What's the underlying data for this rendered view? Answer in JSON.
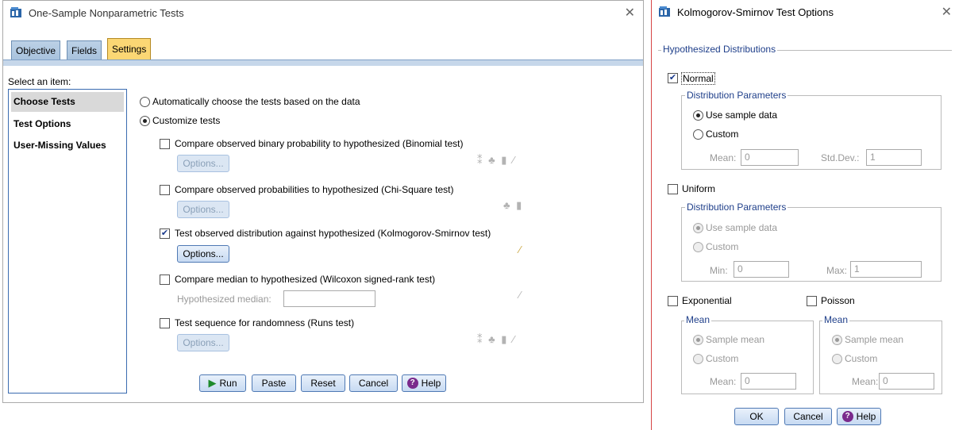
{
  "left_window": {
    "title": "One-Sample Nonparametric Tests",
    "tabs": [
      "Objective",
      "Fields",
      "Settings"
    ],
    "select_item_label": "Select an item:",
    "items": [
      "Choose Tests",
      "Test Options",
      "User-Missing Values"
    ],
    "auto_label": "Automatically choose the tests based on the data",
    "customize_label": "Customize tests",
    "tests": [
      {
        "label": "Compare observed binary probability to hypothesized (Binomial test)",
        "checked": false,
        "icons": "⁑ ♣ ▮ ∕"
      },
      {
        "label": "Compare observed probabilities to hypothesized (Chi-Square test)",
        "checked": false,
        "icons": "♣ ▮"
      },
      {
        "label": "Test observed distribution against hypothesized (Kolmogorov-Smirnov test)",
        "checked": true,
        "icons": "∕"
      },
      {
        "label": "Compare median to hypothesized (Wilcoxon signed-rank test)",
        "checked": false,
        "icons": "∕"
      },
      {
        "label": "Test sequence for randomness (Runs test)",
        "checked": false,
        "icons": "⁑ ♣ ▮ ∕"
      }
    ],
    "options_label": "Options...",
    "hyp_median_label": "Hypothesized median:",
    "buttons": {
      "run": "Run",
      "paste": "Paste",
      "reset": "Reset",
      "cancel": "Cancel",
      "help": "Help"
    }
  },
  "right_window": {
    "title": "Kolmogorov-Smirnov Test Options",
    "hyp_dist_label": "Hypothesized Distributions",
    "normal": {
      "label": "Normal",
      "checked": true
    },
    "dist_params_label": "Distribution Parameters",
    "use_sample_label": "Use sample data",
    "custom_label": "Custom",
    "mean_label": "Mean:",
    "mean_value": "0",
    "stddev_label": "Std.Dev.:",
    "stddev_value": "1",
    "uniform": {
      "label": "Uniform",
      "checked": false
    },
    "min_label": "Min:",
    "min_value": "0",
    "max_label": "Max:",
    "max_value": "1",
    "exponential": {
      "label": "Exponential",
      "checked": false
    },
    "poisson": {
      "label": "Poisson",
      "checked": false
    },
    "mean_group_label": "Mean",
    "sample_mean_label": "Sample mean",
    "exp_mean_value": "0",
    "poi_mean_value": "0",
    "buttons": {
      "ok": "OK",
      "cancel": "Cancel",
      "help": "Help"
    }
  }
}
